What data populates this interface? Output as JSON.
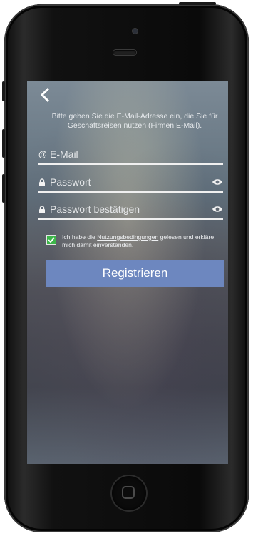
{
  "header": {
    "back_icon": "chevron-left-icon"
  },
  "intro_text": "Bitte geben Sie die E-Mail-Adresse ein, die Sie für Geschäftsreisen nutzen (Firmen E-Mail).",
  "form": {
    "email": {
      "icon": "@",
      "placeholder": "E-Mail",
      "value": ""
    },
    "password": {
      "icon": "lock-icon",
      "placeholder": "Passwort",
      "value": "",
      "toggle_icon": "eye-icon"
    },
    "password_confirm": {
      "icon": "lock-icon",
      "placeholder": "Passwort bestätigen",
      "value": "",
      "toggle_icon": "eye-icon"
    }
  },
  "agreement": {
    "checked": true,
    "text_before": "Ich habe die ",
    "link": "Nutzungsbedingungen",
    "text_after": " gelesen und erkläre mich damit einverstanden."
  },
  "submit_label": "Registrieren",
  "colors": {
    "button": "#6d87bf",
    "checkbox": "#3db54a",
    "text": "#eef0f2"
  }
}
